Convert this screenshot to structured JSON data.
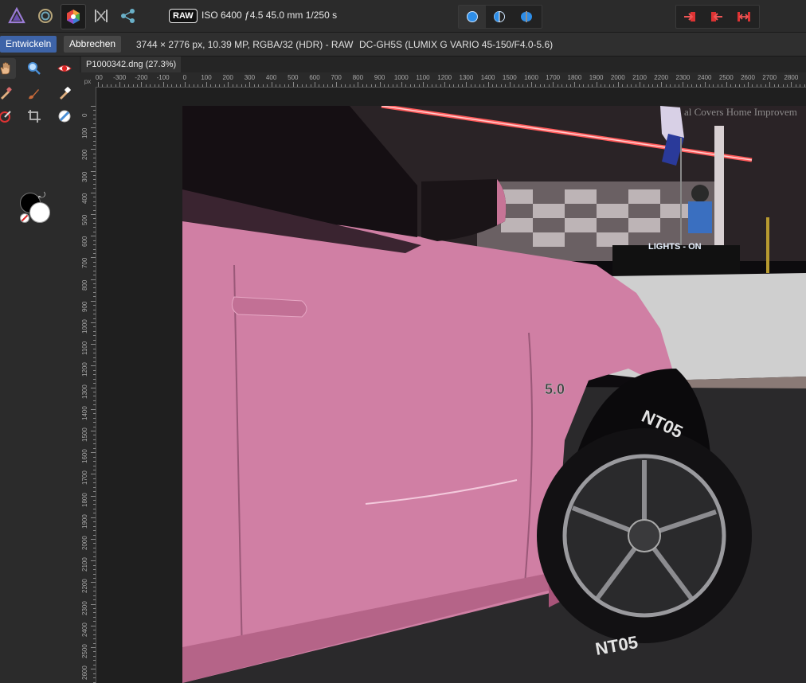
{
  "toolbar": {
    "personas": [
      "photo-persona-icon",
      "liquify-persona-icon",
      "develop-persona-icon",
      "tone-mapping-persona-icon",
      "export-persona-icon"
    ],
    "raw_badge": "RAW",
    "exif": "ISO 6400 ƒ4.5 45.0 mm 1/250 s",
    "view_modes": [
      "single-view-icon",
      "split-view-icon",
      "mirror-view-icon"
    ],
    "nav_buttons": [
      "arrow-right-icon",
      "arrow-left-icon",
      "arrow-both-icon"
    ]
  },
  "context": {
    "develop_label": "Entwickeln",
    "cancel_label": "Abbrechen",
    "image_info": "3744 × 2776 px, 10.39 MP, RGBA/32 (HDR) - RAW",
    "camera_info": "DC-GH5S (LUMIX G VARIO 45-150/F4.0-5.6)"
  },
  "document": {
    "tab_title": "P1000342.dng (27.3%)"
  },
  "ruler": {
    "unit": "px",
    "top_labels": [
      "-00",
      "-300",
      "-200",
      "-100",
      "0",
      "100",
      "200",
      "300",
      "400",
      "500",
      "600",
      "700",
      "800",
      "900",
      "1000",
      "1100",
      "1200",
      "1300",
      "1400",
      "1500",
      "1600",
      "1700",
      "1800",
      "1900",
      "2000",
      "2100",
      "2200",
      "2300",
      "2400",
      "2500",
      "2600",
      "2700",
      "2800"
    ],
    "left_labels": [
      "0",
      "100",
      "200",
      "300",
      "400",
      "500",
      "600",
      "700",
      "800",
      "900",
      "1000",
      "1100",
      "1200",
      "1300",
      "1400",
      "1500",
      "1600",
      "1700",
      "1800",
      "1900",
      "2000",
      "2100",
      "2200",
      "2300",
      "2400",
      "2500",
      "2600"
    ]
  },
  "photo": {
    "sign_text": "LIGHTS - ON",
    "building_text": "al Covers Home Improvem",
    "badge_text": "5.0",
    "tire_text": "NT05",
    "colors": {
      "car_pink": "#d07fa4",
      "neon_red": "#ff5a5a",
      "wall": "#cfcfcf",
      "asphalt": "#2a292b"
    }
  },
  "colors": {
    "accent": "#3e64a8",
    "panel": "#2b2b2b"
  }
}
